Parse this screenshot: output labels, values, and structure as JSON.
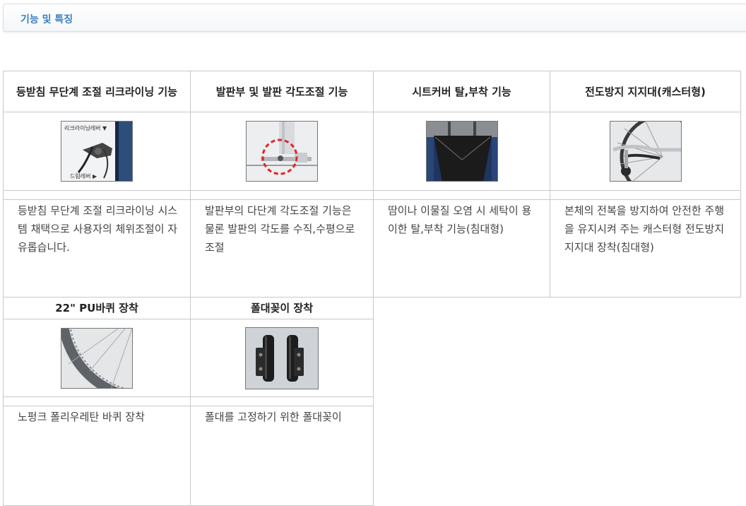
{
  "section": {
    "title": "기능 및 특징"
  },
  "features": [
    {
      "title": "등받침 무단계 조절 리크라이닝 기능",
      "description": "등받침 무단계 조절 리크라이닝 시스템 채택으로 사용자의 체위조절이 자유롭습니다.",
      "image": {
        "icon": "recline-lever-photo",
        "labels": [
          "리크라이닝레버 ▼",
          "드럼레버 ▶"
        ]
      }
    },
    {
      "title": "발판부 및 발판 각도조절 기능",
      "description": "발판부의 다단계 각도조절 기능은 물론 발판의 각도를 수직,수평으로 조절",
      "image": {
        "icon": "footrest-angle-photo"
      }
    },
    {
      "title": "시트커버 탈,부착 기능",
      "description": "땀이나 이물질 오염 시 세탁이 용이한 탈,부착 기능(침대형)",
      "image": {
        "icon": "seat-cover-photo"
      }
    },
    {
      "title": "전도방지 지지대(캐스터형)",
      "description": "본체의 전복을 방지하여 안전한 주행을 유지시켜 주는 캐스터형 전도방지 지지대 장착(침대형)",
      "image": {
        "icon": "anti-tip-caster-photo"
      }
    },
    {
      "title": "22\" PU바퀴 장착",
      "description": "노펑크 폴리우레탄 바퀴 장착",
      "image": {
        "icon": "pu-wheel-photo"
      }
    },
    {
      "title": "폴대꽂이 장착",
      "description": "폴대를 고정하기 위한 폴대꽂이",
      "image": {
        "icon": "pole-holder-photo"
      }
    }
  ],
  "colors": {
    "section_title": "#3a7fc0",
    "border": "#c8c8c8",
    "red_marker": "#e02424"
  }
}
